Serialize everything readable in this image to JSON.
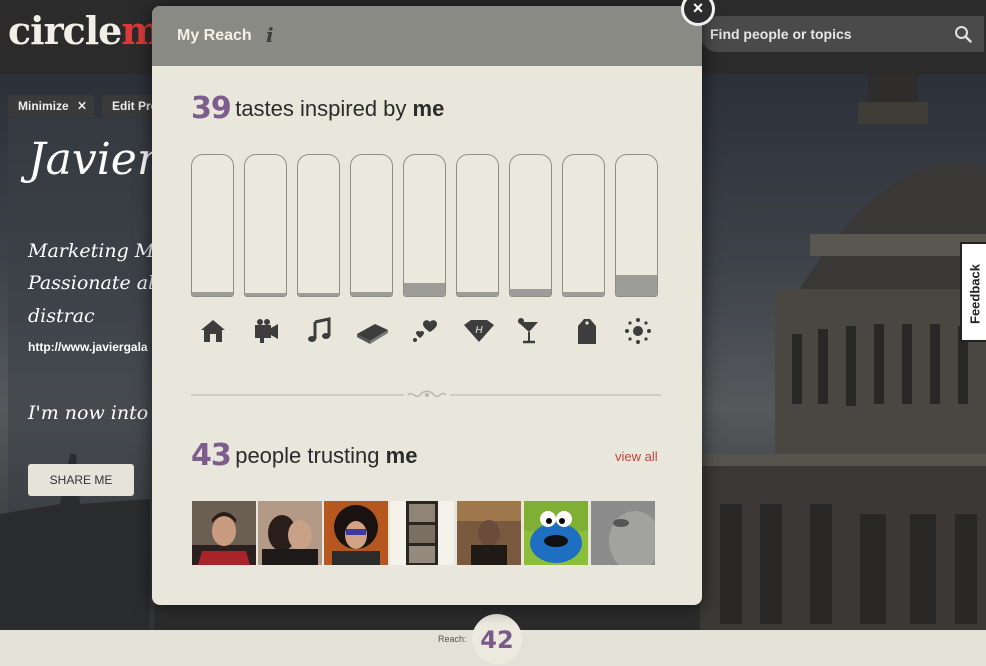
{
  "app": {
    "logo_part1": "circle",
    "logo_part2": "m"
  },
  "search": {
    "placeholder": "Find people or topics",
    "icon": "search-icon"
  },
  "feedback_tab": "Feedback",
  "profile": {
    "minimize_label": "Minimize",
    "edit_label": "Edit Pro",
    "name": "Javier",
    "bio_line1": "Marketing Mana",
    "bio_line2": "Passionate al",
    "bio_line3": "distrac",
    "url": "http://www.javiergala",
    "status": "I'm now into",
    "share_label": "SHARE ME"
  },
  "reach_bar": {
    "label": "Reach:",
    "value": "42"
  },
  "modal": {
    "title": "My Reach",
    "info_icon": "i",
    "close_label": "×",
    "tastes": {
      "count": "39",
      "label": "tastes inspired by",
      "emphasis": "me",
      "categories": [
        {
          "icon": "home-icon",
          "level": 0.03
        },
        {
          "icon": "video-camera-icon",
          "level": 0.02
        },
        {
          "icon": "music-note-icon",
          "level": 0.02
        },
        {
          "icon": "book-icon",
          "level": 0.03
        },
        {
          "icon": "hearts-icon",
          "level": 0.09
        },
        {
          "icon": "diamond-icon",
          "level": 0.03
        },
        {
          "icon": "cocktail-icon",
          "level": 0.05
        },
        {
          "icon": "shopping-bag-icon",
          "level": 0.03
        },
        {
          "icon": "sparkle-icon",
          "level": 0.15
        }
      ]
    },
    "people": {
      "count": "43",
      "label": "people trusting",
      "emphasis": "me",
      "view_all": "view all",
      "avatars": [
        "avatar-man-red-scarf",
        "avatar-couple-hug",
        "avatar-curly-hair-glasses",
        "avatar-photo-strip",
        "avatar-man-dark-room",
        "avatar-cookie-monster",
        "avatar-grey-face"
      ]
    }
  },
  "colors": {
    "accent_purple": "#7c5d8e",
    "link_red": "#c9413d",
    "logo_red": "#d93a3a",
    "modal_bg": "#e9e7dc",
    "modal_header": "#8a8a84"
  }
}
